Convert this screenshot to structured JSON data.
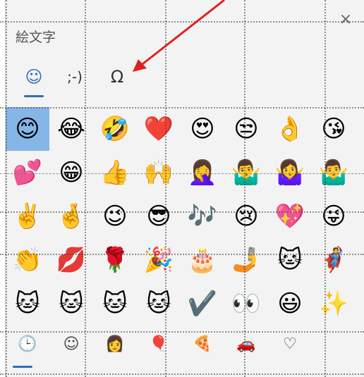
{
  "header": {
    "title": "絵文字",
    "close_label": "×"
  },
  "tabs": [
    {
      "label": "☺",
      "active": true
    },
    {
      "label": ";-)",
      "active": false
    },
    {
      "label": "Ω",
      "active": false
    }
  ],
  "emojis": [
    "😊",
    "😂",
    "🤣",
    "❤️",
    "😍",
    "😒",
    "👌",
    "😘",
    "💕",
    "😁",
    "👍",
    "🙌",
    "🤦‍♀️",
    "🤷‍♂️",
    "🤷‍♀️",
    "🤷‍♂️",
    "✌️",
    "🤞",
    "😉",
    "😎",
    "🎶",
    "😢",
    "💖",
    "😜",
    "👏",
    "💋",
    "🌹",
    "🎉",
    "🎂",
    "🤳",
    "🐱",
    "🦸",
    "🐱",
    "🐱",
    "🐱",
    "🐱",
    "✔️",
    "👀",
    "😃",
    "✨"
  ],
  "bottom_tabs": [
    {
      "label": "🕒",
      "name": "recent",
      "active": true
    },
    {
      "label": "☺",
      "name": "smileys",
      "active": false
    },
    {
      "label": "👩",
      "name": "people",
      "active": false
    },
    {
      "label": "🎈",
      "name": "celebration",
      "active": false
    },
    {
      "label": "🍕",
      "name": "food",
      "active": false
    },
    {
      "label": "🚗",
      "name": "travel",
      "active": false
    },
    {
      "label": "♡",
      "name": "symbols",
      "active": false
    }
  ],
  "colors": {
    "accent": "#2b6fb7",
    "selected": "#86b6e8",
    "arrow": "#e0201e"
  }
}
